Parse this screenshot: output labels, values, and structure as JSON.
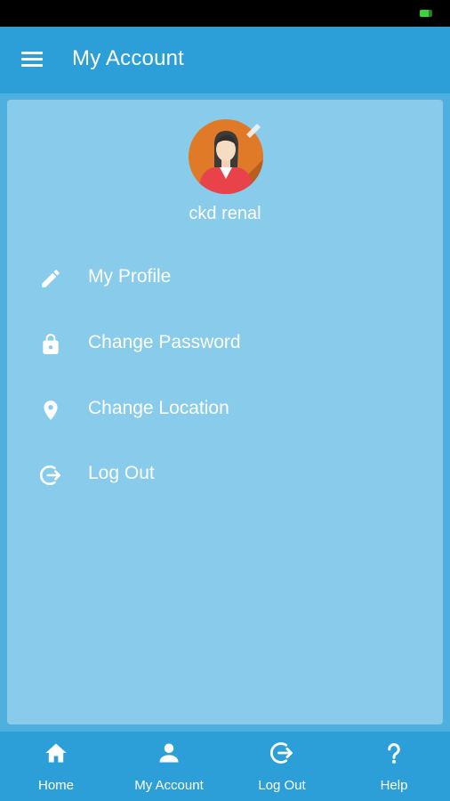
{
  "statusbar": {
    "battery_level": 0.7,
    "battery_color": "#39d43a"
  },
  "appbar": {
    "title": "My Account",
    "menu_icon": "hamburger-menu-icon",
    "color": "#2d9fd8"
  },
  "profile": {
    "avatar_icon": "user-avatar-icon",
    "edit_icon": "edit-pencil-icon",
    "username": "ckd renal"
  },
  "menu": {
    "items": [
      {
        "label": "My Profile",
        "icon": "pencil-icon"
      },
      {
        "label": "Change Password",
        "icon": "lock-icon"
      },
      {
        "label": "Change Location",
        "icon": "location-pin-icon"
      },
      {
        "label": "Log Out",
        "icon": "logout-icon"
      }
    ]
  },
  "bottom_nav": {
    "items": [
      {
        "label": "Home",
        "icon": "home-icon"
      },
      {
        "label": "My Account",
        "icon": "person-icon"
      },
      {
        "label": "Log Out",
        "icon": "logout-icon"
      },
      {
        "label": "Help",
        "icon": "help-icon"
      }
    ]
  },
  "colors": {
    "background": "#4fb0e0",
    "card": "#88cbeb",
    "text": "#ffffff"
  }
}
